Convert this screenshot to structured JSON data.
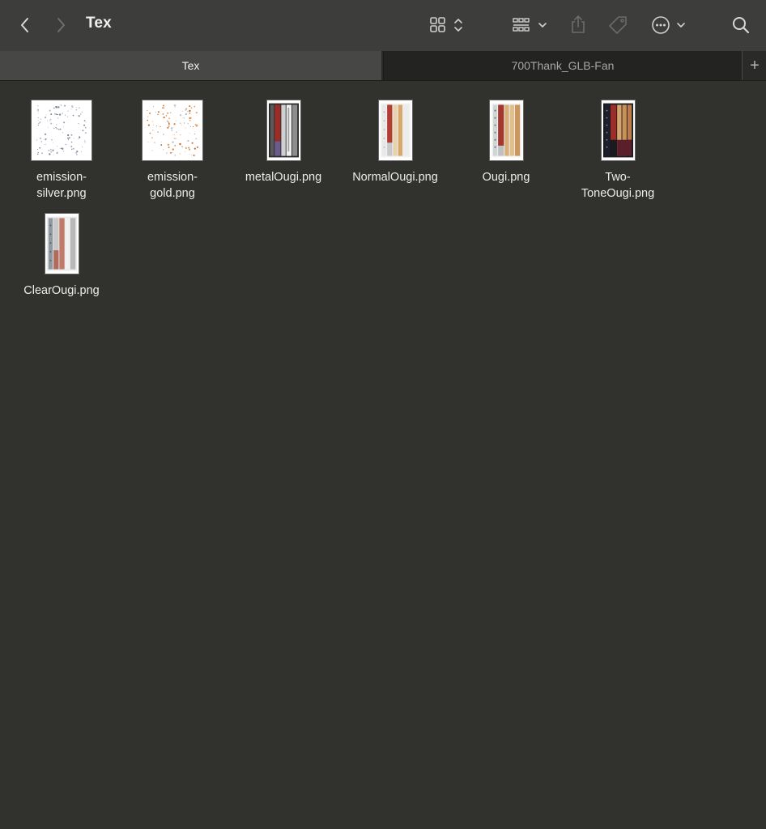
{
  "window": {
    "title": "Tex"
  },
  "toolbar": {
    "back_icon": "chevron-left-icon",
    "forward_icon": "chevron-right-icon",
    "view_icon": "grid-view-icon",
    "group_icon": "group-by-icon",
    "share_icon": "share-icon",
    "tag_icon": "tag-icon",
    "more_icon": "more-actions-icon",
    "search_icon": "search-icon"
  },
  "tabs": [
    {
      "label": "Tex",
      "active": true
    },
    {
      "label": "700Thank_GLB-Fan",
      "active": false
    }
  ],
  "tab_add_label": "+",
  "files": [
    {
      "name_line1": "emission-",
      "name_line2": "silver.png",
      "kind": "scatter-silver"
    },
    {
      "name_line1": "emission-",
      "name_line2": "gold.png",
      "kind": "scatter-gold"
    },
    {
      "name_line1": "metalOugi.png",
      "name_line2": "",
      "kind": "strip-metal"
    },
    {
      "name_line1": "NormalOugi.png",
      "name_line2": "",
      "kind": "strip-normal"
    },
    {
      "name_line1": "Ougi.png",
      "name_line2": "",
      "kind": "strip-ougi"
    },
    {
      "name_line1": "Two-",
      "name_line2": "ToneOugi.png",
      "kind": "strip-twotone"
    },
    {
      "name_line1": "ClearOugi.png",
      "name_line2": "",
      "kind": "strip-clear"
    }
  ],
  "colors": {
    "background": "#31312e",
    "toolbar": "#3d3d3b",
    "active_tab": "#474745",
    "red_strip": "#a3362d",
    "gold_dot": "#d9823f",
    "wood": "#d8b07a"
  }
}
